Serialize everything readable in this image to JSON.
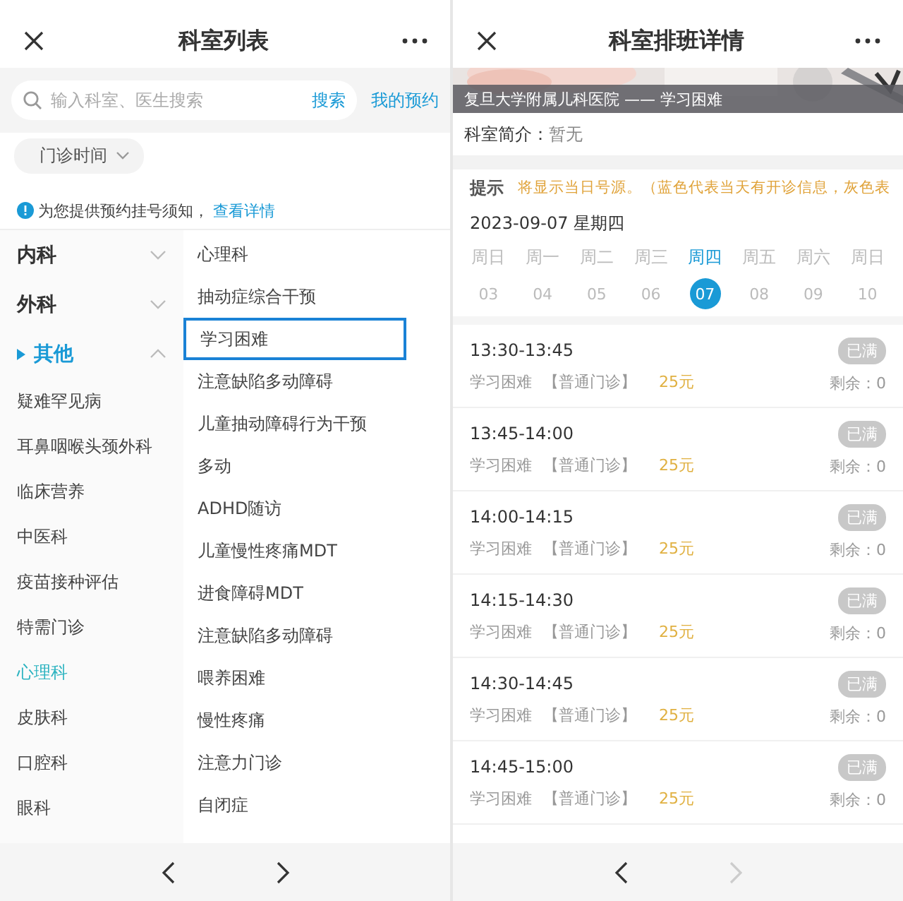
{
  "left_screen": {
    "title": "科室列表",
    "search": {
      "placeholder": "输入科室、医生搜索",
      "button": "搜索"
    },
    "my_appointments": "我的预约",
    "filter": {
      "label": "门诊时间"
    },
    "notice": {
      "text": "为您提供预约挂号须知，",
      "link": "查看详情"
    },
    "categories": [
      {
        "label": "内科",
        "expanded": false
      },
      {
        "label": "外科",
        "expanded": false
      },
      {
        "label": "其他",
        "expanded": true,
        "children": [
          {
            "label": "疑难罕见病",
            "selected": false
          },
          {
            "label": "耳鼻咽喉头颈外科",
            "selected": false
          },
          {
            "label": "临床营养",
            "selected": false
          },
          {
            "label": "中医科",
            "selected": false
          },
          {
            "label": "疫苗接种评估",
            "selected": false
          },
          {
            "label": "特需门诊",
            "selected": false
          },
          {
            "label": "心理科",
            "selected": true
          },
          {
            "label": "皮肤科",
            "selected": false
          },
          {
            "label": "口腔科",
            "selected": false
          },
          {
            "label": "眼科",
            "selected": false
          }
        ]
      }
    ],
    "departments": [
      {
        "label": "心理科",
        "selected": false
      },
      {
        "label": "抽动症综合干预",
        "selected": false
      },
      {
        "label": "学习困难",
        "selected": true
      },
      {
        "label": "注意缺陷多动障碍",
        "selected": false
      },
      {
        "label": "儿童抽动障碍行为干预",
        "selected": false
      },
      {
        "label": "多动",
        "selected": false
      },
      {
        "label": "ADHD随访",
        "selected": false
      },
      {
        "label": "儿童慢性疼痛MDT",
        "selected": false
      },
      {
        "label": "进食障碍MDT",
        "selected": false
      },
      {
        "label": "注意缺陷多动障碍",
        "selected": false
      },
      {
        "label": "喂养困难",
        "selected": false
      },
      {
        "label": "慢性疼痛",
        "selected": false
      },
      {
        "label": "注意力门诊",
        "selected": false
      },
      {
        "label": "自闭症",
        "selected": false
      }
    ],
    "nav": [
      {
        "kind": "back",
        "disabled": false
      },
      {
        "kind": "forward",
        "disabled": false
      }
    ]
  },
  "right_screen": {
    "title": "科室排班详情",
    "banner": {
      "kind": "picture",
      "caption": "复旦大学附属儿科医院 —— 学习困难"
    },
    "intro": {
      "label": "科室简介：",
      "value": "暂无"
    },
    "tip": {
      "label": "提示",
      "text": "将显示当日号源。（蓝色代表当天有开诊信息，灰色表"
    },
    "date": "2023-09-07 星期四",
    "days": [
      {
        "weekday": "周日",
        "day": "03",
        "selected": false
      },
      {
        "weekday": "周一",
        "day": "04",
        "selected": false
      },
      {
        "weekday": "周二",
        "day": "05",
        "selected": false
      },
      {
        "weekday": "周三",
        "day": "06",
        "selected": false
      },
      {
        "weekday": "周四",
        "day": "07",
        "selected": true
      },
      {
        "weekday": "周五",
        "day": "08",
        "selected": false
      },
      {
        "weekday": "周六",
        "day": "09",
        "selected": false
      },
      {
        "weekday": "周日",
        "day": "10",
        "selected": false
      }
    ],
    "slots": [
      {
        "time": "13:30-13:45",
        "department": "学习困难",
        "type": "【普通门诊】",
        "price": "25元",
        "status": "已满",
        "remaining": "剩余：0"
      },
      {
        "time": "13:45-14:00",
        "department": "学习困难",
        "type": "【普通门诊】",
        "price": "25元",
        "status": "已满",
        "remaining": "剩余：0"
      },
      {
        "time": "14:00-14:15",
        "department": "学习困难",
        "type": "【普通门诊】",
        "price": "25元",
        "status": "已满",
        "remaining": "剩余：0"
      },
      {
        "time": "14:15-14:30",
        "department": "学习困难",
        "type": "【普通门诊】",
        "price": "25元",
        "status": "已满",
        "remaining": "剩余：0"
      },
      {
        "time": "14:30-14:45",
        "department": "学习困难",
        "type": "【普通门诊】",
        "price": "25元",
        "status": "已满",
        "remaining": "剩余：0"
      },
      {
        "time": "14:45-15:00",
        "department": "学习困难",
        "type": "【普通门诊】",
        "price": "25元",
        "status": "已满",
        "remaining": "剩余：0"
      }
    ],
    "nav": [
      {
        "kind": "back",
        "disabled": false
      },
      {
        "kind": "forward",
        "disabled": true
      }
    ]
  }
}
